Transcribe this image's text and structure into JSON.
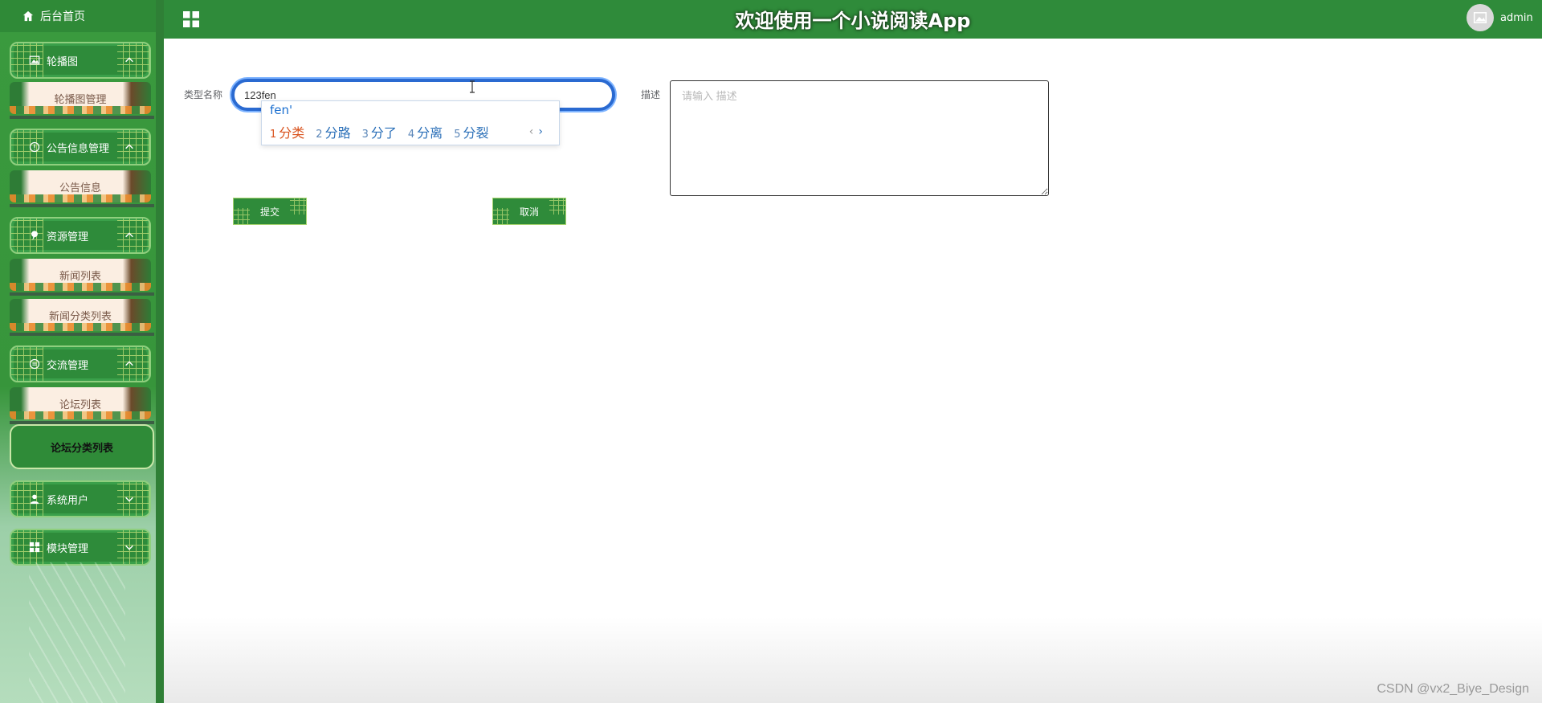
{
  "header": {
    "title": "欢迎使用一个小说阅读App",
    "username": "admin",
    "menu_icon": "grid-icon",
    "avatar_icon": "image-icon"
  },
  "sidebar": {
    "home": {
      "label": "后台首页",
      "icon": "home-icon"
    },
    "groups": [
      {
        "label": "轮播图",
        "icon": "image-icon",
        "expanded": true,
        "items": [
          "轮播图管理"
        ]
      },
      {
        "label": "公告信息管理",
        "icon": "info-circle-icon",
        "expanded": true,
        "items": [
          "公告信息"
        ]
      },
      {
        "label": "资源管理",
        "icon": "pin-icon",
        "expanded": true,
        "items": [
          "新闻列表",
          "新闻分类列表"
        ]
      },
      {
        "label": "交流管理",
        "icon": "chat-icon",
        "expanded": true,
        "items": [
          "论坛列表",
          "论坛分类列表"
        ]
      },
      {
        "label": "系统用户",
        "icon": "user-icon",
        "expanded": false,
        "items": []
      },
      {
        "label": "模块管理",
        "icon": "grid-icon",
        "expanded": false,
        "items": []
      }
    ],
    "active_item": "论坛分类列表"
  },
  "form": {
    "type_name_label": "类型名称",
    "type_name_value": "123fen",
    "desc_label": "描述",
    "desc_placeholder": "请输入 描述",
    "submit_label": "提交",
    "cancel_label": "取消"
  },
  "ime": {
    "composition": "fen'",
    "candidates": [
      {
        "num": "1",
        "text": "分类"
      },
      {
        "num": "2",
        "text": "分路"
      },
      {
        "num": "3",
        "text": "分了"
      },
      {
        "num": "4",
        "text": "分离"
      },
      {
        "num": "5",
        "text": "分裂"
      }
    ],
    "prev": "‹",
    "next": "›"
  },
  "watermark": "CSDN @vx2_Biye_Design",
  "colors": {
    "primary_green": "#2f8b3a",
    "accent_blue": "#2a6ad1",
    "ime_active": "#d9531e"
  }
}
